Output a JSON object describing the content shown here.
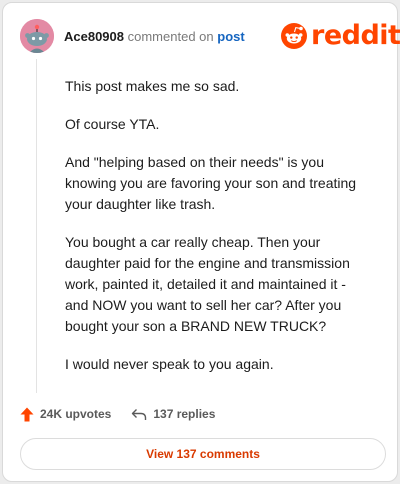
{
  "colors": {
    "brand": "#ff4500",
    "link": "#1565c0",
    "avatar_bg": "#e38aa4",
    "upvote": "#ff4500"
  },
  "header": {
    "username": "Ace80908",
    "action_text": "commented on",
    "post_link": "post",
    "logo_text": "reddit",
    "avatar_icon": "snoo-avatar-icon",
    "logo_icon": "reddit-snoo-icon"
  },
  "comment": {
    "paragraphs": [
      "This post makes me so sad.",
      "Of course YTA.",
      "And \"helping based on their needs\" is you knowing you are favoring your son and treating your daughter like trash.",
      "You bought a car really cheap. Then your daughter paid for the engine and transmission work, painted it, detailed it and maintained it - and NOW you want to sell her car? After you bought your son a BRAND NEW TRUCK?",
      "I would never speak to you again."
    ]
  },
  "actions": {
    "upvotes": "24K upvotes",
    "replies": "137 replies",
    "upvote_icon": "upvote-arrow-icon",
    "reply_icon": "reply-arrow-icon"
  },
  "footer": {
    "view_label": "View 137 comments"
  }
}
